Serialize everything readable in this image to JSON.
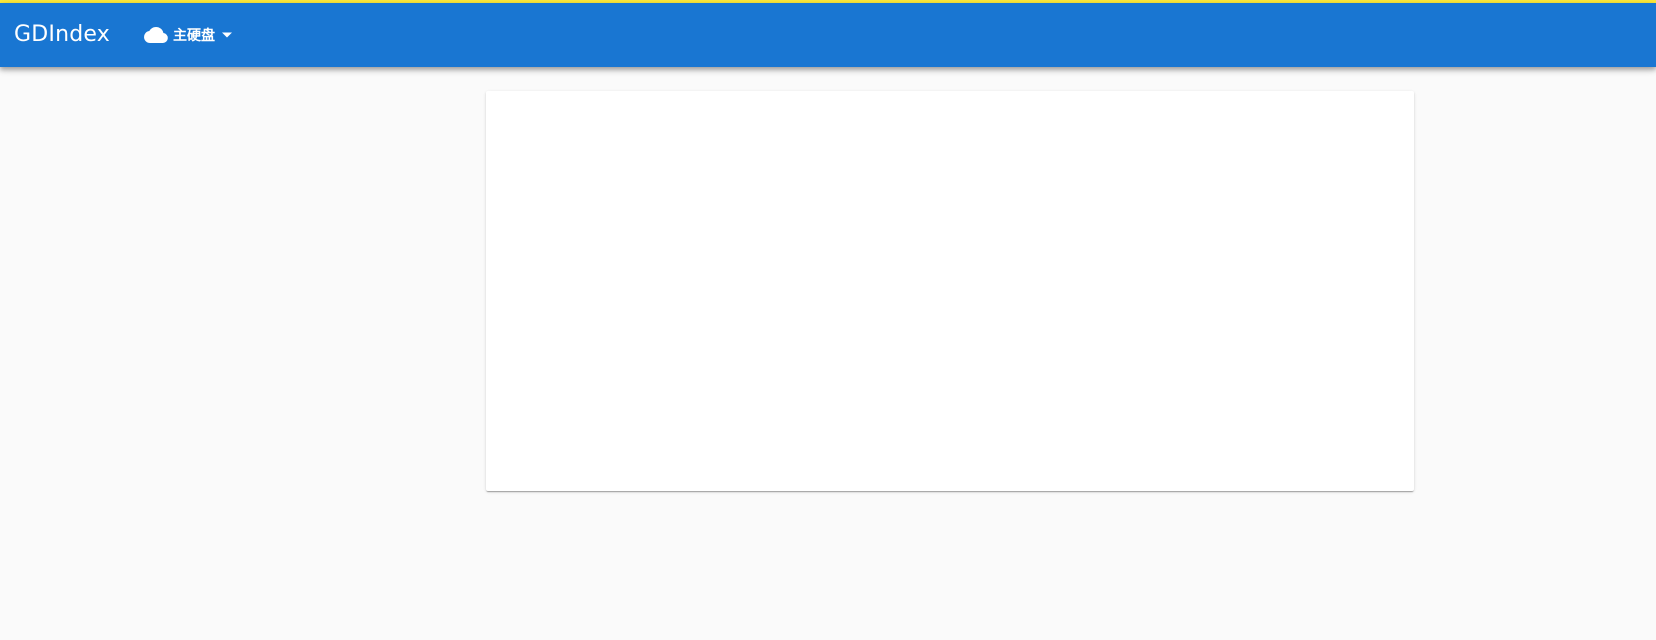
{
  "app": {
    "title": "GDIndex"
  },
  "drive_menu": {
    "selected_drive": "主硬盘",
    "icon": "cloud-icon",
    "dropdown_icon": "caret-down-icon"
  },
  "colors": {
    "app_bar": "#1976d2",
    "top_strip": "#ffeb3b",
    "background": "#fafafa",
    "card": "#ffffff",
    "text_on_bar": "#ffffff"
  }
}
